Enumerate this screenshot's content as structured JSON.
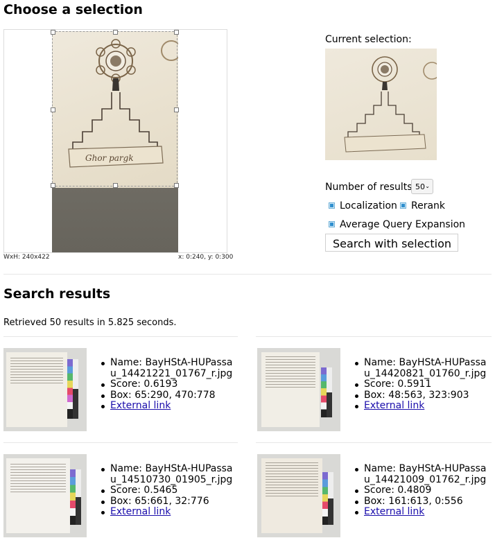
{
  "page": {
    "title": "Choose a selection",
    "results_title": "Search results"
  },
  "cropper": {
    "size_readout": "WxH: 240x422",
    "coords_readout": "x: 0:240, y: 0:300",
    "image_text": "Ghor pargk"
  },
  "selection": {
    "current_label": "Current selection:",
    "num_results_label": "Number of results:",
    "num_results_value": "50",
    "options": [
      {
        "label": "Localization",
        "checked": true
      },
      {
        "label": "Rerank",
        "checked": true
      },
      {
        "label": "Average Query Expansion",
        "checked": true
      }
    ],
    "search_button": "Search with selection"
  },
  "summary": "Retrieved 50 results in 5.825 seconds.",
  "results": [
    {
      "name": "Name: BayHStA-HUPassau_14421221_01767_r.jpg",
      "score": "Score: 0.6193",
      "box": "Box: 65:290, 470:778",
      "link": "External link"
    },
    {
      "name": "Name: BayHStA-HUPassau_14420821_01760_r.jpg",
      "score": "Score: 0.5911",
      "box": "Box: 48:563, 323:903",
      "link": "External link"
    },
    {
      "name": "Name: BayHStA-HUPassau_14510730_01905_r.jpg",
      "score": "Score: 0.5465",
      "box": "Box: 65:661, 32:776",
      "link": "External link"
    },
    {
      "name": "Name: BayHStA-HUPassau_14421009_01762_r.jpg",
      "score": "Score: 0.4809",
      "box": "Box: 161:613, 0:556",
      "link": "External link"
    }
  ]
}
